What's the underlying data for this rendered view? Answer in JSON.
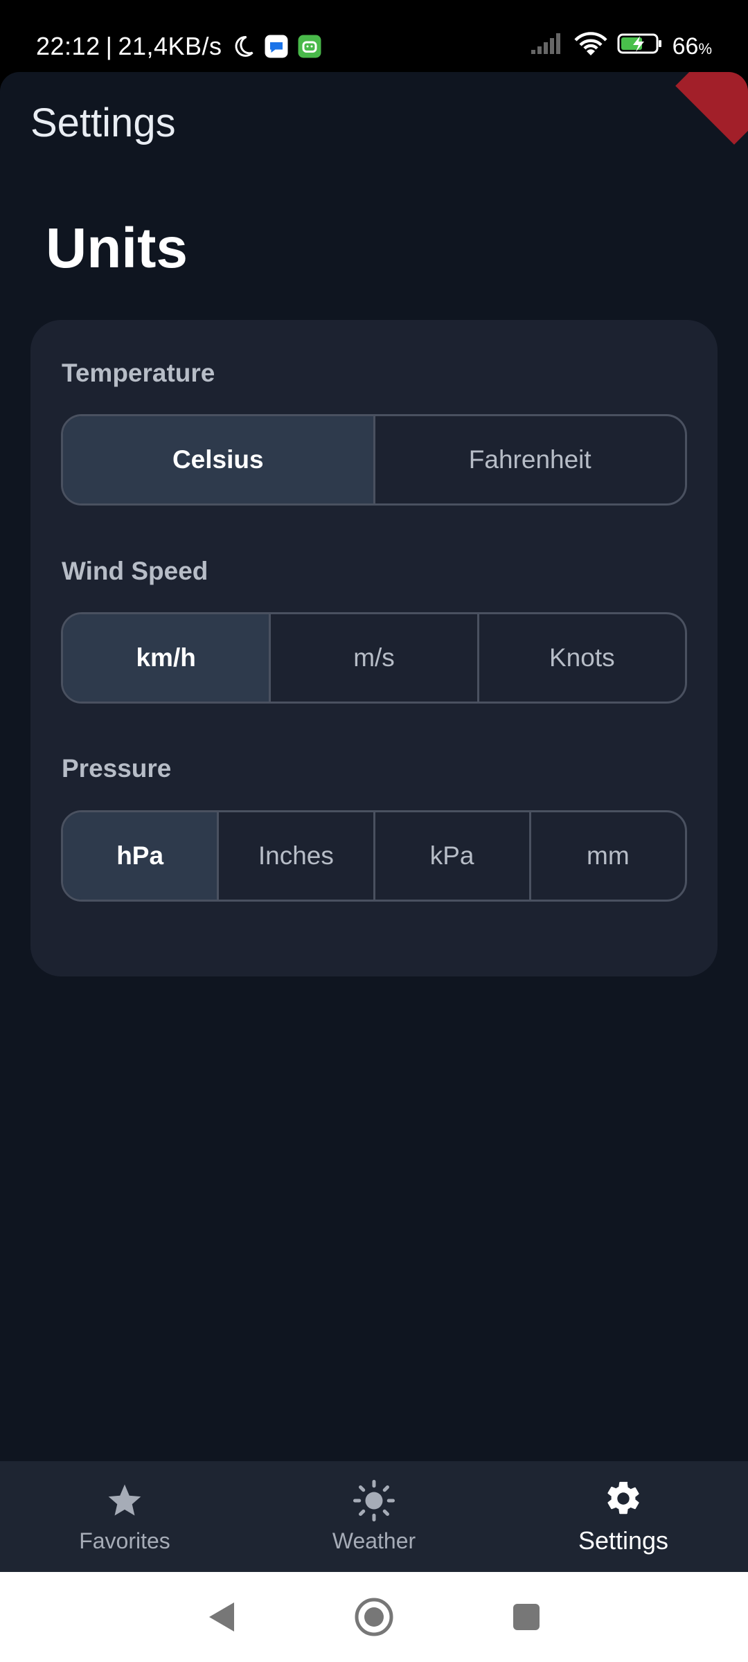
{
  "status_bar": {
    "time": "22:12",
    "separator": "|",
    "speed": "21,4KB/s",
    "battery_percent": "66",
    "battery_symbol": "%"
  },
  "app": {
    "title": "Settings",
    "section_title": "Units"
  },
  "groups": {
    "temperature": {
      "label": "Temperature",
      "options": [
        "Celsius",
        "Fahrenheit"
      ],
      "selected": "Celsius"
    },
    "wind_speed": {
      "label": "Wind Speed",
      "options": [
        "km/h",
        "m/s",
        "Knots"
      ],
      "selected": "km/h"
    },
    "pressure": {
      "label": "Pressure",
      "options": [
        "hPa",
        "Inches",
        "kPa",
        "mm"
      ],
      "selected": "hPa"
    }
  },
  "bottom_nav": {
    "items": [
      {
        "label": "Favorites",
        "icon": "star-icon"
      },
      {
        "label": "Weather",
        "icon": "sun-icon"
      },
      {
        "label": "Settings",
        "icon": "gear-icon",
        "active": true
      }
    ]
  },
  "colors": {
    "background": "#0f1520",
    "card": "#1c2230",
    "selected_segment": "#2e3a4c",
    "nav_bar": "#1e2532"
  }
}
